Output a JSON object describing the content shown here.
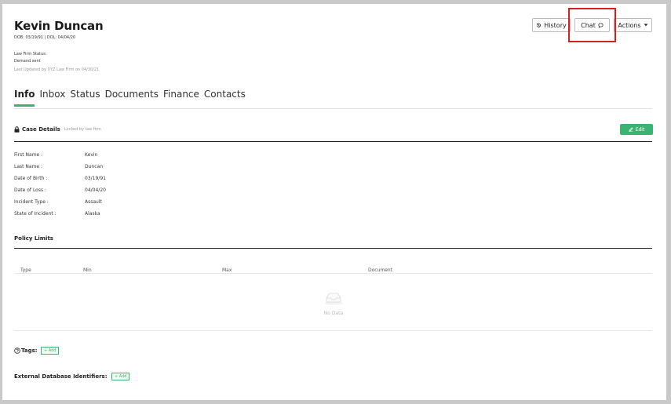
{
  "header": {
    "name": "Kevin Duncan",
    "dates": "DOB: 03/19/91 | DOL: 04/04/20",
    "law_firm_status": "Law Firm Status:",
    "demand": "Demand sent",
    "last_updated": "Last Updated by XYZ Law Firm on 04/30/21"
  },
  "toolbar": {
    "history_label": "History",
    "chat_label": "Chat",
    "actions_label": "Actions"
  },
  "tabs": [
    {
      "label": "Info",
      "active": true
    },
    {
      "label": "Inbox"
    },
    {
      "label": "Status"
    },
    {
      "label": "Documents"
    },
    {
      "label": "Finance"
    },
    {
      "label": "Contacts"
    }
  ],
  "case_details": {
    "title": "Case Details",
    "locked_note": "Locked by law firm",
    "edit_label": "Edit",
    "fields": [
      {
        "label": "First Name :",
        "value": "Kevin"
      },
      {
        "label": "Last Name :",
        "value": "Duncan"
      },
      {
        "label": "Date of Birth :",
        "value": "03/19/91"
      },
      {
        "label": "Date of Loss :",
        "value": "04/04/20"
      },
      {
        "label": "Incident Type :",
        "value": "Assault"
      },
      {
        "label": "State of Incident :",
        "value": "Alaska"
      }
    ]
  },
  "policy_limits": {
    "title": "Policy Limits",
    "columns": [
      "Type",
      "Min",
      "Max",
      "Document"
    ],
    "empty_text": "No Data"
  },
  "tags": {
    "label": "Tags:",
    "add_label": "+ Add"
  },
  "external_ids": {
    "label": "External Database Identifiers:",
    "add_label": "+ Add"
  },
  "colors": {
    "accent": "#3cb371",
    "highlight": "#d62020"
  }
}
